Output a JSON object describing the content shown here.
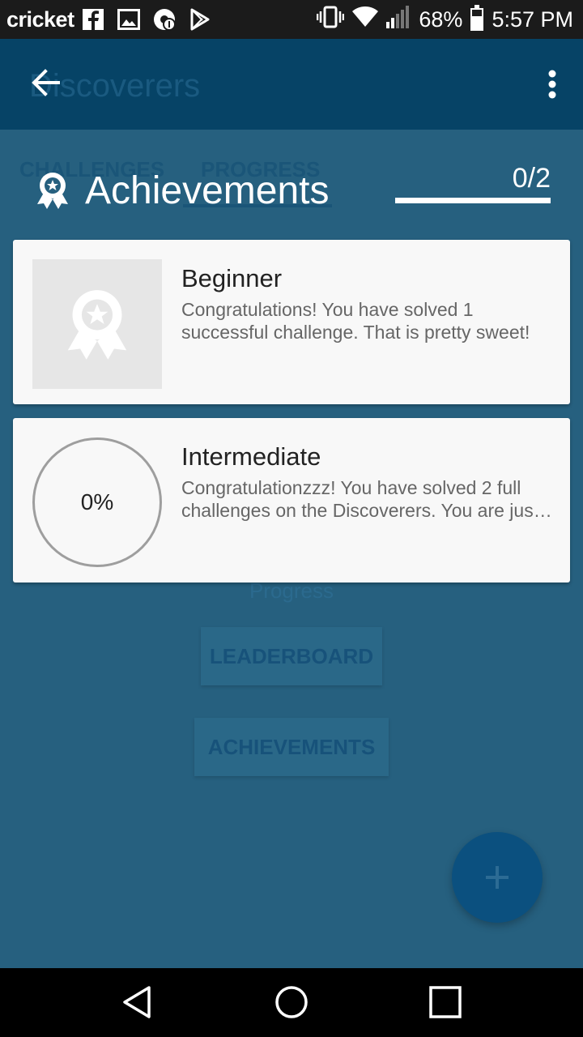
{
  "status_bar": {
    "carrier": "cricket",
    "icons": [
      "facebook-icon",
      "image-icon",
      "chrome-icon",
      "play-store-icon"
    ],
    "battery": "68%",
    "time": "5:57 PM"
  },
  "toolbar": {
    "title": "Discoverers"
  },
  "underlying": {
    "tabs": [
      {
        "label": "CHALLENGES"
      },
      {
        "label": "PROGRESS"
      }
    ],
    "progress_label": "Progress",
    "leaderboard_button": "LEADERBOARD",
    "achievements_button": "ACHIEVEMENTS",
    "fab_symbol": "+"
  },
  "achievements": {
    "title": "Achievements",
    "count": "0/2",
    "progress_fraction": 0.0,
    "items": [
      {
        "title": "Beginner",
        "desc_line1": "Congratulations! You have solved 1",
        "desc_line2": "successful challenge. That is pretty sweet!"
      },
      {
        "title": "Intermediate",
        "progress": "0%",
        "desc_line1": "Congratulationzzz! You have solved 2 full",
        "desc_line2": "challenges on the Discoverers. You are just getting started"
      }
    ]
  },
  "colors": {
    "background": "#26607f",
    "toolbar": "#064366",
    "card": "#f8f8f8"
  }
}
